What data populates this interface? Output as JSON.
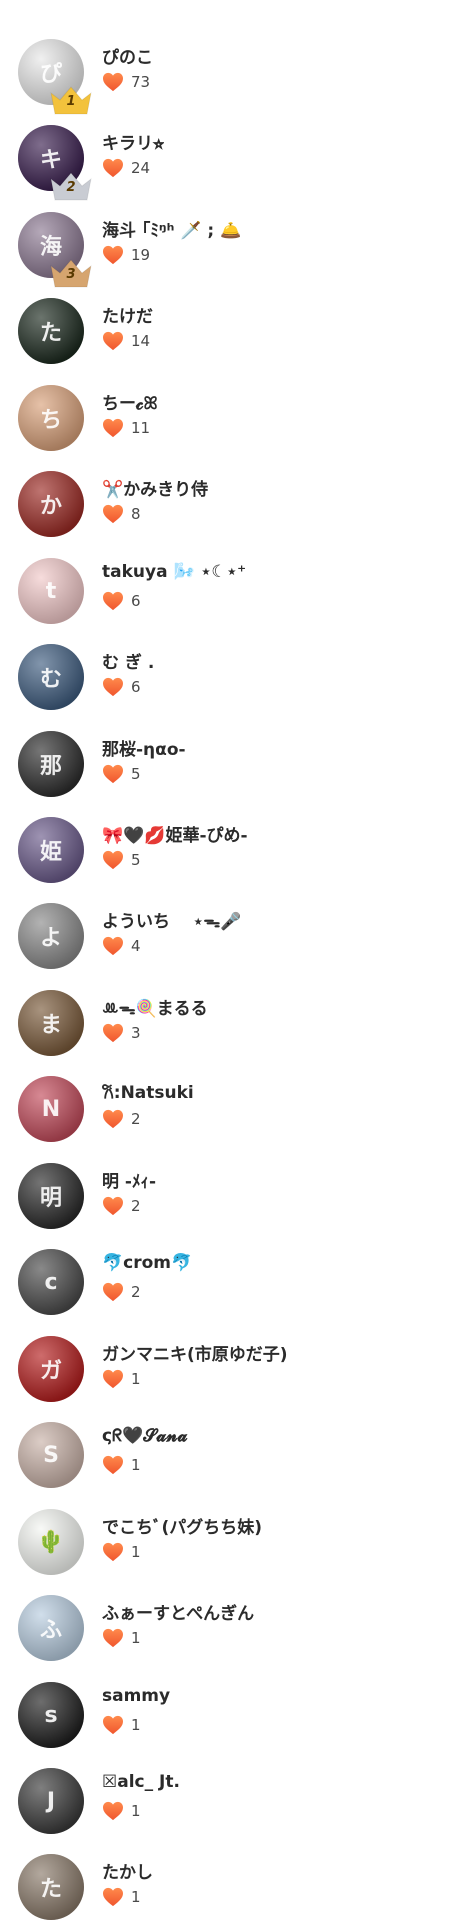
{
  "users": [
    {
      "name": "ぴのこ",
      "likes": "73",
      "rank": "1",
      "avatar_color": "#e8e8e8",
      "initial": "ぴ",
      "crown_color": "#f3c23c"
    },
    {
      "name": "キラリ⭐︎",
      "likes": "24",
      "rank": "2",
      "avatar_color": "#3a1f4f",
      "initial": "キ",
      "crown_color": "#c9ccd3"
    },
    {
      "name": "海斗 ｢ﾐᵑʰ 🗡️ ; 🛎️",
      "likes": "19",
      "rank": "3",
      "avatar_color": "#8d7a93",
      "initial": "海",
      "crown_color": "#d6a56f"
    },
    {
      "name": "たけだ",
      "likes": "14",
      "avatar_color": "#1c2a1f",
      "initial": "た"
    },
    {
      "name": "ちー𝓬ꕤ",
      "likes": "11",
      "avatar_color": "#d9a17a",
      "initial": "ち"
    },
    {
      "name": "✂️かみきり侍",
      "likes": "8",
      "avatar_color": "#9c2a24",
      "initial": "か"
    },
    {
      "name": "takuya 🌬️ ⋆☾⋆⁺",
      "likes": "6",
      "avatar_color": "#f2c9c9",
      "initial": "t"
    },
    {
      "name": "む ぎ .",
      "likes": "6",
      "avatar_color": "#3f5d80",
      "initial": "む"
    },
    {
      "name": "那桜-ηαo-",
      "likes": "5",
      "avatar_color": "#2d2d2d",
      "initial": "那"
    },
    {
      "name": "🎀🖤💋姫華-ぴめ-",
      "likes": "5",
      "avatar_color": "#6a5a8a",
      "initial": "姫"
    },
    {
      "name": "よういち　 ⋆ᯓ🎤",
      "likes": "4",
      "avatar_color": "#8a8a8a",
      "initial": "よ"
    },
    {
      "name": "ꔛᯓ🍭まるる",
      "likes": "3",
      "avatar_color": "#7a5a3a",
      "initial": "ま"
    },
    {
      "name": "𐙚:Natsuki",
      "likes": "2",
      "avatar_color": "#c24a5a",
      "initial": "N"
    },
    {
      "name": "明 -ﾒｨ-",
      "likes": "2",
      "avatar_color": "#2a2a2a",
      "initial": "明"
    },
    {
      "name": "🐬crom🐬",
      "likes": "2",
      "avatar_color": "#4a4a4a",
      "initial": "c"
    },
    {
      "name": "ガンマニキ(市原ゆだ子)",
      "likes": "1",
      "avatar_color": "#b41d1d",
      "initial": "ガ"
    },
    {
      "name": "ςᖇ🖤𝓢𝓪𝓷𝓪",
      "likes": "1",
      "avatar_color": "#c9b2a8",
      "initial": "S"
    },
    {
      "name": "でこちﾞ(パグちち妹)",
      "likes": "1",
      "avatar_color": "#f4f6f2",
      "initial": "🌵"
    },
    {
      "name": "ふぁーすとぺんぎん",
      "likes": "1",
      "avatar_color": "#b8cde0",
      "initial": "ふ"
    },
    {
      "name": "sammy",
      "likes": "1",
      "avatar_color": "#1f1f1f",
      "initial": "s"
    },
    {
      "name": "☒alc_ Jt.",
      "likes": "1",
      "avatar_color": "#3a3a3a",
      "initial": "J"
    },
    {
      "name": "たかし",
      "likes": "1",
      "avatar_color": "#8a7a6a",
      "initial": "た"
    }
  ]
}
